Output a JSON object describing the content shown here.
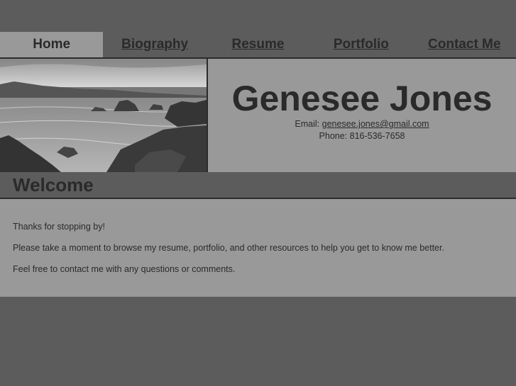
{
  "nav": {
    "items": [
      {
        "label": "Home",
        "active": true
      },
      {
        "label": "Biography",
        "active": false
      },
      {
        "label": "Resume",
        "active": false
      },
      {
        "label": "Portfolio",
        "active": false
      },
      {
        "label": "Contact Me",
        "active": false
      }
    ]
  },
  "header": {
    "name": "Genesee Jones",
    "email_label": "Email:",
    "email": "genesee.jones@gmail.com",
    "phone": "Phone: 816-536-7658"
  },
  "welcome": {
    "title": "Welcome"
  },
  "content": {
    "paragraphs": [
      "Thanks for stopping by!",
      "Please take a moment to browse my resume, portfolio, and other resources to help you get to know me better.",
      "Feel free to contact me with any questions or comments."
    ]
  },
  "colors": {
    "background": "#5c5c5c",
    "panel": "#999999",
    "text": "#2a2a2a",
    "border": "#2b2b2b"
  }
}
